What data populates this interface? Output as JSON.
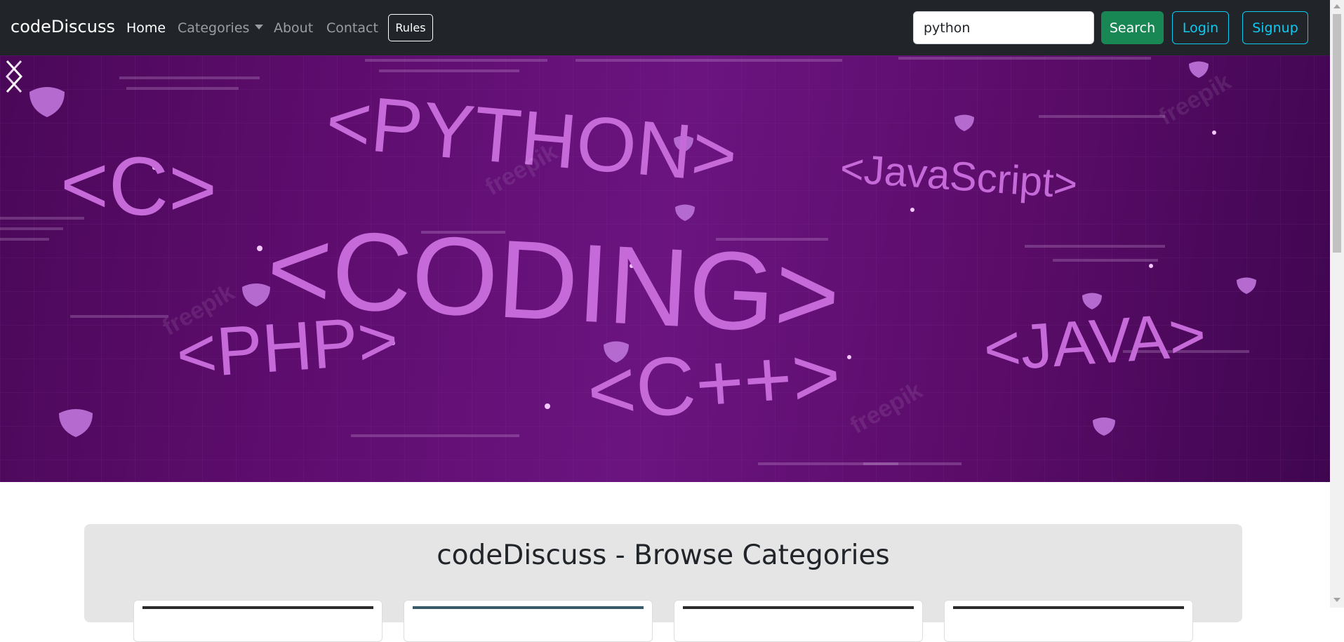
{
  "navbar": {
    "brand": "codeDiscuss",
    "links": {
      "home": "Home",
      "categories": "Categories",
      "about": "About",
      "contact": "Contact"
    },
    "rules_label": "Rules",
    "search": {
      "value": "python",
      "placeholder": "Search"
    },
    "search_button": "Search",
    "login_button": "Login",
    "signup_button": "Signup"
  },
  "hero": {
    "words": {
      "c": "<C>",
      "python": "<PYTHON>",
      "javascript": "<JavaScript>",
      "coding": "<CODING>",
      "php": "<PHP>",
      "cpp": "<C++>",
      "java": "<JAVA>"
    },
    "watermark": "freepik"
  },
  "categories": {
    "title": "codeDiscuss - Browse Categories"
  },
  "colors": {
    "navbar_bg": "#212529",
    "success": "#198754",
    "info": "#0dcaf0",
    "hero_text": "#c56ad8",
    "section_bg": "#e5e5e6"
  }
}
